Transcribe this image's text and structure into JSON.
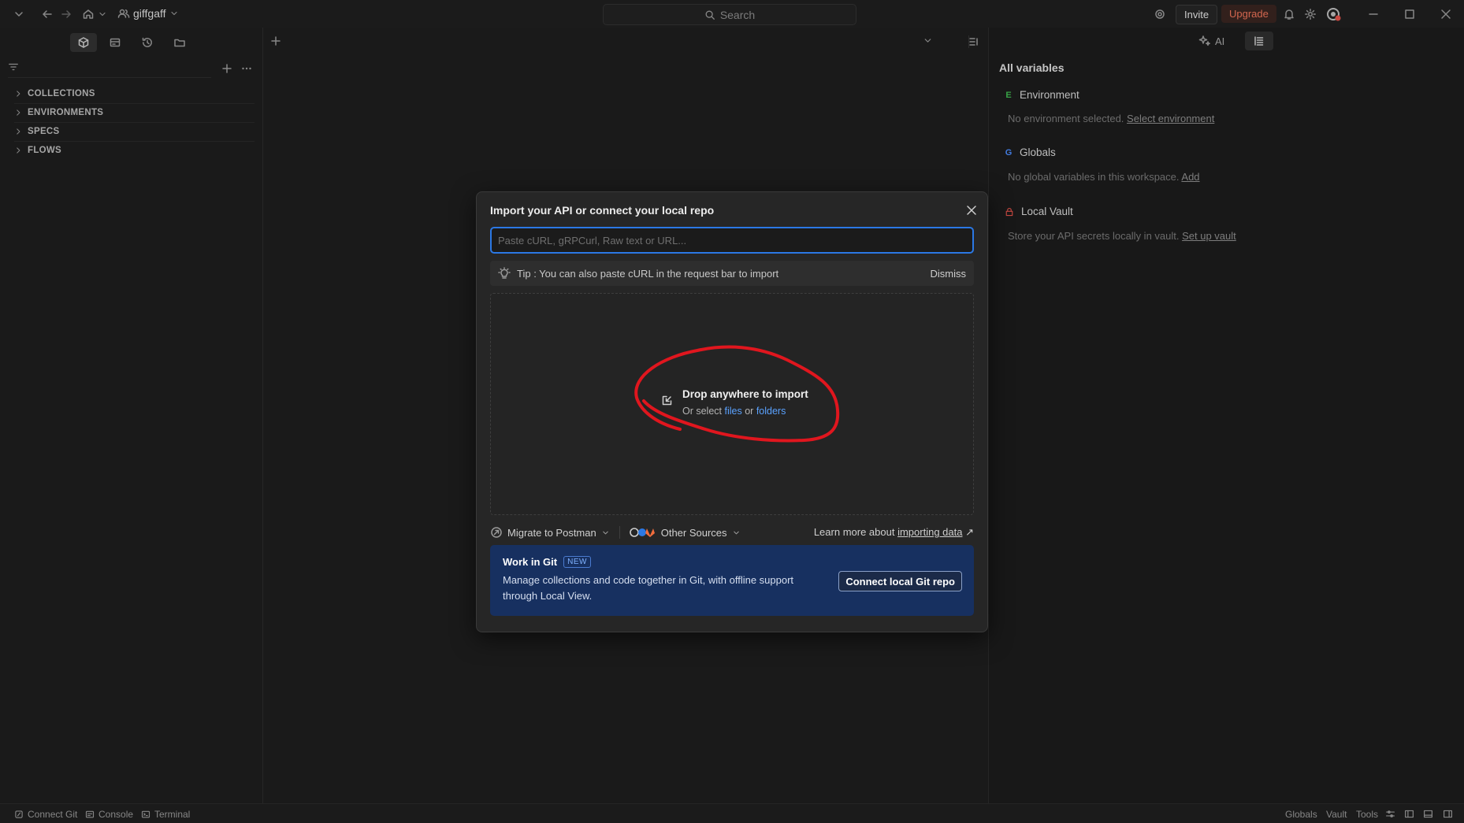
{
  "titlebar": {
    "workspace_name": "giffgaff",
    "search_label": "Search",
    "invite_label": "Invite",
    "upgrade_label": "Upgrade"
  },
  "sidebar": {
    "tree": [
      {
        "label": "COLLECTIONS"
      },
      {
        "label": "ENVIRONMENTS"
      },
      {
        "label": "SPECS"
      },
      {
        "label": "FLOWS"
      }
    ]
  },
  "right_panel": {
    "ai_label": "AI",
    "title": "All variables",
    "environment": {
      "badge": "E",
      "label": "Environment",
      "text": "No environment selected.",
      "link": "Select environment",
      "badge_color": "#3fb950"
    },
    "globals": {
      "badge": "G",
      "label": "Globals",
      "text": "No global variables in this workspace.",
      "link": "Add",
      "badge_color": "#4c8dff"
    },
    "vault": {
      "label": "Local Vault",
      "text": "Store your API secrets locally in vault.",
      "link": "Set up vault",
      "icon_color": "#e5534b"
    }
  },
  "modal": {
    "title": "Import your API or connect your local repo",
    "input_placeholder": "Paste cURL, gRPCurl, Raw text or URL...",
    "input_value": "",
    "tip": "Tip : You can also paste cURL in the request bar to import",
    "dismiss_label": "Dismiss",
    "drop_title": "Drop anywhere to import",
    "drop_prefix": "Or select",
    "drop_files": "files",
    "drop_or": "or",
    "drop_folders": "folders",
    "migrate_label": "Migrate to Postman",
    "other_sources_label": "Other Sources",
    "learn_more_prefix": "Learn more about",
    "learn_more_link": "importing data",
    "learn_more_arrow": "↗",
    "git_card": {
      "title": "Work in Git",
      "badge": "NEW",
      "description": "Manage collections and code together in Git, with offline support through Local View.",
      "button": "Connect local Git repo"
    }
  },
  "statusbar": {
    "left": [
      "Connect Git",
      "Console",
      "Terminal"
    ],
    "right": [
      "Globals",
      "Vault",
      "Tools"
    ]
  },
  "colors": {
    "accent_blue": "#2b78e4",
    "upgrade": "#f0755a",
    "annotation_red": "#e0161e",
    "git_card_bg": "#173060"
  }
}
